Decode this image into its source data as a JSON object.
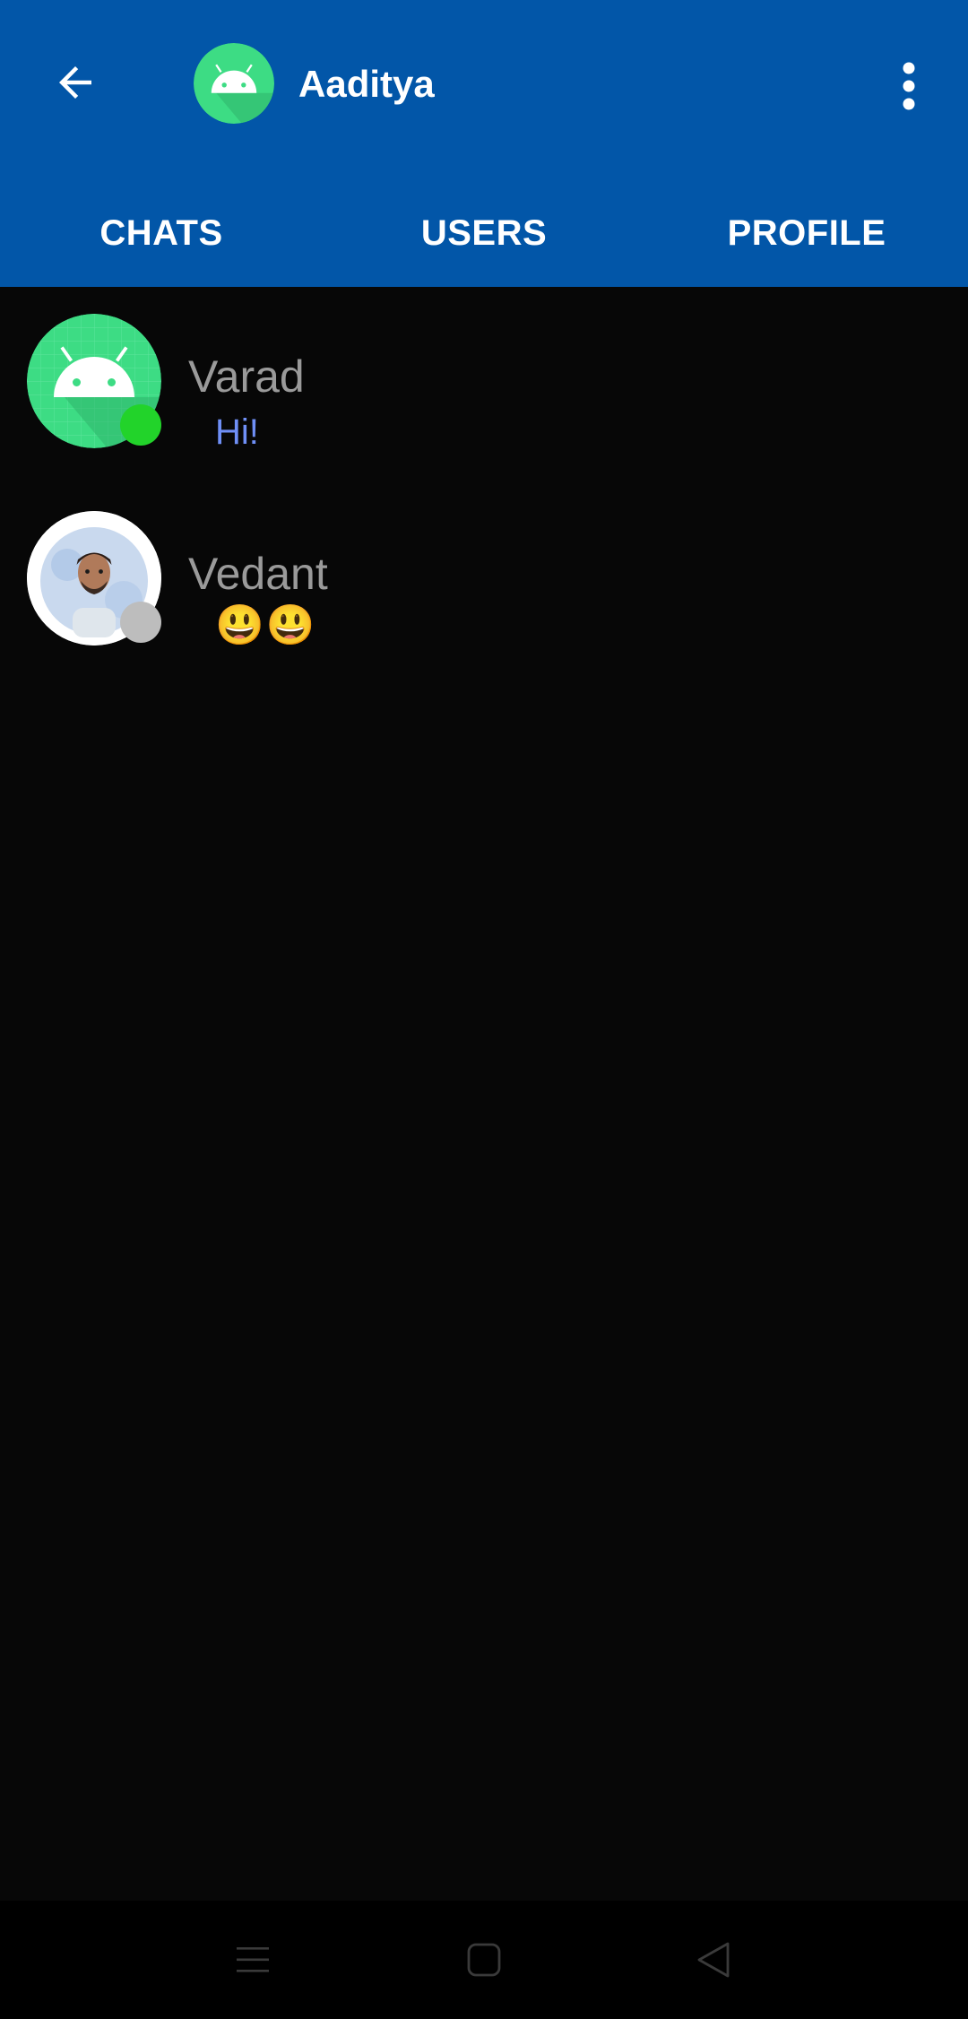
{
  "header": {
    "title": "Aaditya",
    "back_icon": "arrow-left-icon",
    "more_icon": "more-vert-icon",
    "avatar_icon": "android-avatar-icon",
    "background": "#0256a8"
  },
  "tabs": [
    {
      "label": "CHATS"
    },
    {
      "label": "USERS"
    },
    {
      "label": "PROFILE"
    }
  ],
  "chats": [
    {
      "name": "Varad",
      "message": "Hi!",
      "online": true,
      "avatar": "android-avatar-icon",
      "status_color": "#22d32a"
    },
    {
      "name": "Vedant",
      "message": "😃😃",
      "online": false,
      "avatar": "user-photo",
      "status_color": "#bdbdbd"
    }
  ],
  "colors": {
    "app_bar": "#0256a8",
    "background": "#070707",
    "name_text": "#9a9a9a",
    "message_text": "#6f8ff6",
    "avatar_green": "#3ddc84"
  },
  "navbar": {
    "icons": [
      "menu-icon",
      "home-square-icon",
      "back-triangle-icon"
    ]
  }
}
